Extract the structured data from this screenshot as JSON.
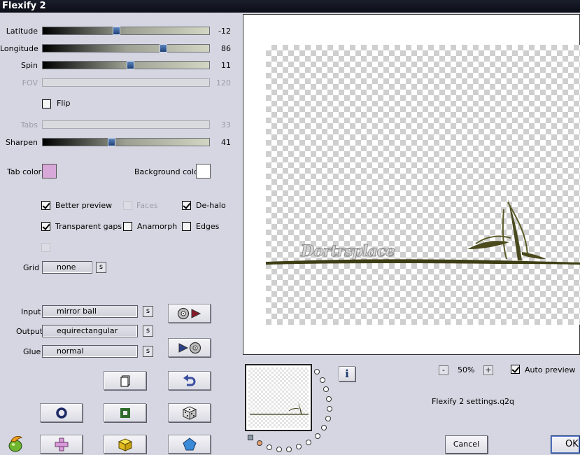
{
  "window": {
    "title": "Flexify 2"
  },
  "sliders": [
    {
      "label": "Latitude",
      "value": "-12",
      "position": 0.44,
      "enabled": true
    },
    {
      "label": "Longitude",
      "value": "86",
      "position": 0.72,
      "enabled": true
    },
    {
      "label": "Spin",
      "value": "11",
      "position": 0.52,
      "enabled": true
    },
    {
      "label": "FOV",
      "value": "120",
      "enabled": false
    },
    {
      "label": "Tabs",
      "value": "33",
      "enabled": false
    },
    {
      "label": "Sharpen",
      "value": "41",
      "position": 0.41,
      "enabled": true
    }
  ],
  "flip": {
    "label": "Flip",
    "checked": false
  },
  "tab_color": {
    "label": "Tab color",
    "color": "#d8a8d8"
  },
  "background_color": {
    "label": "Background color",
    "color": "#ffffff"
  },
  "options": {
    "better_preview": {
      "label": "Better preview",
      "checked": true
    },
    "faces": {
      "label": "Faces",
      "checked": false,
      "enabled": false
    },
    "de_halo": {
      "label": "De-halo",
      "checked": true
    },
    "transparent_gaps": {
      "label": "Transparent gaps",
      "checked": true
    },
    "anamorph": {
      "label": "Anamorph",
      "checked": false
    },
    "edges": {
      "label": "Edges",
      "checked": false
    }
  },
  "grid": {
    "label": "Grid",
    "value": "none",
    "s": "s"
  },
  "input": {
    "label": "Input",
    "value": "mirror ball",
    "s": "s"
  },
  "output": {
    "label": "Output",
    "value": "equirectangular",
    "s": "s"
  },
  "glue": {
    "label": "Glue",
    "value": "normal",
    "s": "s"
  },
  "preview_watermark": "Dortrsplace",
  "zoom": {
    "minus": "-",
    "value": "50%",
    "plus": "+"
  },
  "auto_preview": {
    "label": "Auto preview",
    "checked": true
  },
  "info_button": "i",
  "settings_file": "Flexify 2 settings.q2q",
  "buttons": {
    "cancel": "Cancel",
    "ok": "OK"
  },
  "colors": {
    "title_bar": "#0f1220",
    "background": "#d6d6e2",
    "thumb": "#2c5391"
  }
}
